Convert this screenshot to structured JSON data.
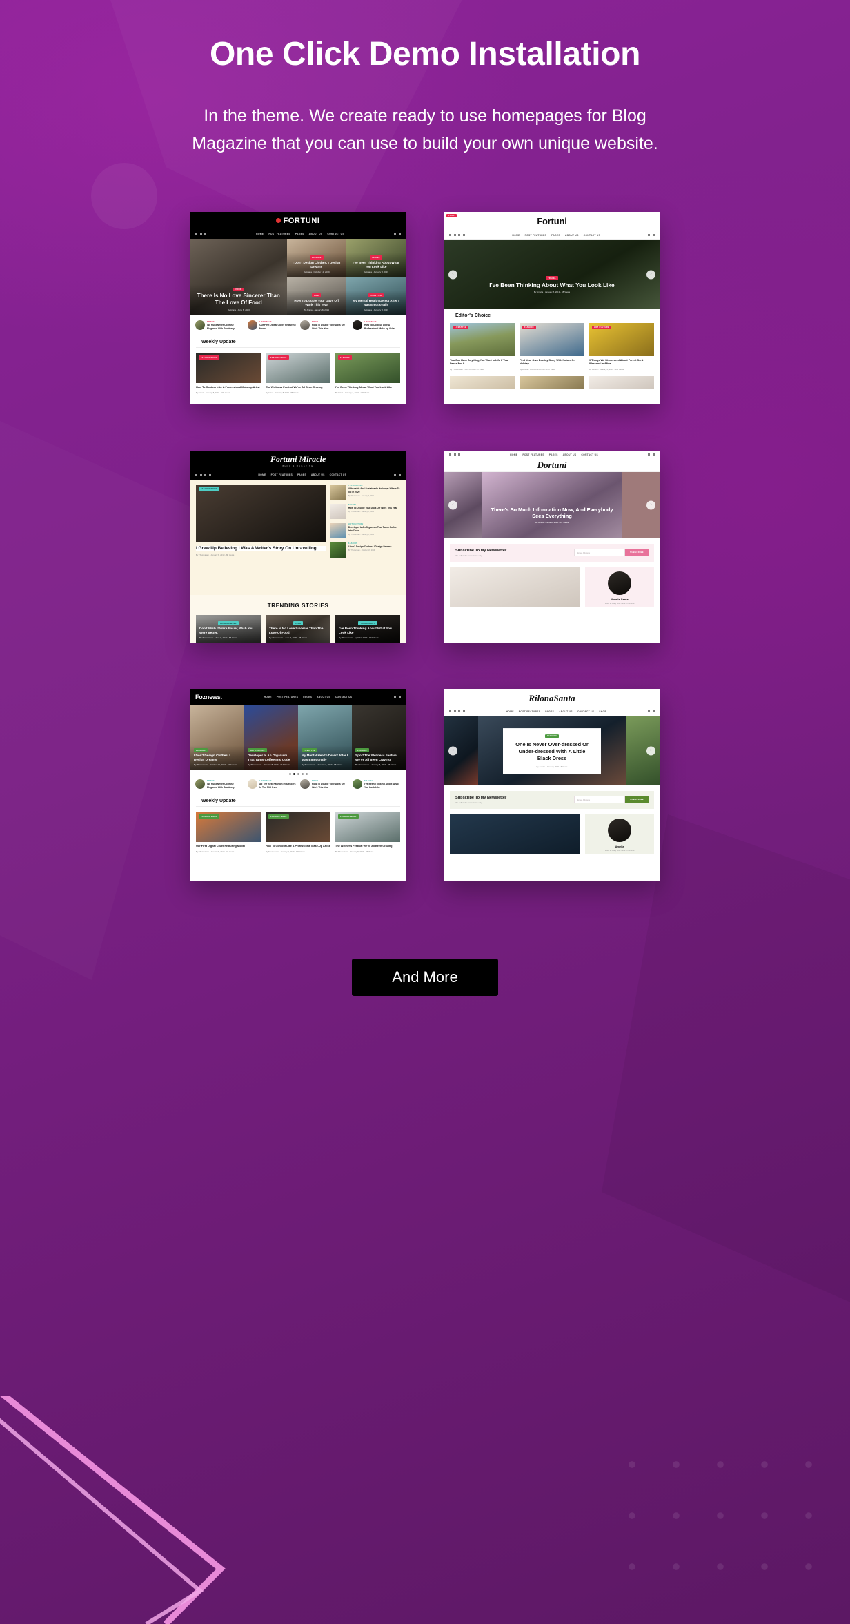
{
  "header": {
    "title": "One Click Demo Installation",
    "subtitle": "In the theme. We create ready to use homepages for Blog Magazine that you can use to build your own unique website."
  },
  "cta": {
    "label": "And More"
  },
  "common": {
    "nav_links": [
      "HOME",
      "POST FEATURES",
      "PAGES",
      "ABOUT US",
      "CONTACT US"
    ],
    "nav_links_shop": [
      "HOME",
      "POST FEATURES",
      "PAGES",
      "ABOUT US",
      "CONTACT US",
      "SHOP"
    ],
    "search_icon": "search-icon",
    "menu_icon": "menu-icon",
    "prev_icon": "‹",
    "next_icon": "›",
    "newsletter_heading": "Subscribe To My Newsletter",
    "newsletter_sub": "We collect the best stories only",
    "newsletter_placeholder": "Email Address",
    "newsletter_button": "SUBSCRIBE"
  },
  "demos": [
    {
      "id": "fortuni-dark",
      "brand": "FORTUNI",
      "hero_main": {
        "badge": "FOOD",
        "title": "There Is No Love Sincerer Than The Love Of Food",
        "meta": "By Arana - June 8, 2020"
      },
      "hero_tiles": [
        {
          "badge": "FASHION",
          "title": "I Don't Design Clothes, I Design Dreams",
          "meta": "By Arana - October 13, 2019"
        },
        {
          "badge": "TRAVEL",
          "title": "I've Been Thinking About What You Look Like",
          "meta": "By Arana - January 8, 2019"
        },
        {
          "badge": "LIFE",
          "title": "How To Double Your Days Off Work This Year",
          "meta": "By Arana - January 8, 2019"
        },
        {
          "badge": "LIFESTYLE",
          "title": "My Mental Health Detect After I Was Emotionally",
          "meta": "By Arana - January 8, 2019"
        }
      ],
      "authors": [
        {
          "cat": "TRAVEL",
          "title": "We Must Never Confuse Elegance With Snobbery"
        },
        {
          "cat": "LIFESTYLE",
          "title": "Our First Digital Cover Featuring Model"
        },
        {
          "cat": "FOOD",
          "title": "How To Double Your Days Off Work This Year"
        },
        {
          "cat": "LIFESTYLE",
          "title": "How To Contour Like A Professional Make-up Artist"
        }
      ],
      "section_title": "Weekly Update",
      "posts": [
        {
          "badge": "FASHION WEEK",
          "title": "How To Contour Like A Professional Make-up Artist",
          "meta": "By Arana - January 8, 2019 - 130 Views"
        },
        {
          "badge": "FASHION WEEK",
          "title": "The Wellness Festival We've All Been Craving",
          "meta": "By Arana - January 8, 2019 - 88 Views"
        },
        {
          "badge": "FASHION",
          "title": "I've Been Thinking About What You Look Like",
          "meta": "By Arana - January 8, 2019 - 130 Views"
        }
      ]
    },
    {
      "id": "fortuni-light",
      "brand": "Fortuni",
      "hero": {
        "badge": "TRAVEL",
        "title": "I've Been Thinking About What You Look Like",
        "meta": "By Amelia - January 8, 2019 - 98 Views"
      },
      "section_title": "Editor's Choice",
      "posts": [
        {
          "badge": "LIFESTYLE",
          "title": "You Can Have Anything You Want In Life If You Dress For It.",
          "meta": "By Themeteam - June 8, 2020 - 5 Views"
        },
        {
          "badge": "FASHION",
          "title": "Find Your Own Destiny Story With Nature On Holiday",
          "meta": "By Amelia - October 13, 2019 - 126 Views"
        },
        {
          "badge": "HOT CULTURE",
          "title": "9 Things We Discovered About Forest On A Weekend In Afica",
          "meta": "By Amelia - January 8, 2019 - 140 Views"
        }
      ]
    },
    {
      "id": "fortuni-miracle",
      "brand": "Fortuni Miracle",
      "brand_sub": "BLOG & MAGAZINE",
      "feature": {
        "badge": "FASHION WEEK",
        "title": "I Grew Up Believing I Was A Writer's Story On Unravelling",
        "meta": "By Themeteam - January 8, 2019 - 88 Views"
      },
      "sidebar_posts": [
        {
          "cat": "TECHNOLOGY",
          "title": "Affordable And Sustainable Holidays: Where To Go In 2020",
          "meta": "By Themeteam - January 8, 2019"
        },
        {
          "cat": "TRAVEL",
          "title": "How To Double Your Days Off Work This Year",
          "meta": "By Themeteam - January 8, 2019"
        },
        {
          "cat": "HOT CULTURE",
          "title": "Developer Is An Organism That Turns Coffee Into Code",
          "meta": "By Themeteam - January 8, 2019"
        },
        {
          "cat": "FASHION",
          "title": "I Don't Design Clothes, I Design Dreams",
          "meta": "By Themeteam - October 13, 2019"
        }
      ],
      "section_title": "TRENDING STORIES",
      "trending": [
        {
          "badge": "FASHION WEEK",
          "title": "Don't Wish It Were Easier, Wish You Were Better.",
          "meta": "By Themeteam - June 8, 2020 - 55 Views"
        },
        {
          "badge": "FOOD",
          "title": "There Is No Love Sincerer Than The Love Of Food.",
          "meta": "By Themeteam - June 8, 2020 - 88 Views"
        },
        {
          "badge": "TECHNOLOGY",
          "title": "I've Been Thinking About What You Look Like",
          "meta": "By Themeteam - April 21, 2019 - 122 Views"
        }
      ]
    },
    {
      "id": "dortuni",
      "brand": "Dortuni",
      "hero": {
        "title": "There's So Much Information Now, And Everybody Sees Everything",
        "meta": "By Amelia - June 8, 2020 - 12 Views"
      },
      "author": {
        "name": "Amalia Santa",
        "desc": "Want to really sexy more. Thandfize"
      }
    },
    {
      "id": "foznews",
      "brand": "Foznews.",
      "hero_tiles": [
        {
          "badge": "FASHION",
          "title": "I Don't Design Clothes, I Design Dreams",
          "meta": "By Themeteam - October 13, 2019 - 198 Views"
        },
        {
          "badge": "HOT CULTURE",
          "title": "Developer Is An Organism That Turns Coffee Into Code",
          "meta": "By Themeteam - January 8, 2019 - 214 Views"
        },
        {
          "badge": "LIFESTYLE",
          "title": "My Mental Health Detect After I Was Emotionally",
          "meta": "By Themeteam - January 8, 2019 - 88 Views"
        },
        {
          "badge": "FASHION",
          "title": "Sport The Wellness Festival We've All Been Craving",
          "meta": "By Themeteam - January 8, 2019 - 36 Views"
        }
      ],
      "authors": [
        {
          "cat": "TRAVEL",
          "title": "We Must Never Confuse Elegance With Snobbery"
        },
        {
          "cat": "LIFESTYLE",
          "title": "All The Best Fashion Influencers In The Mid Over"
        },
        {
          "cat": "FOOD",
          "title": "How To Double Your Days Off Work This Year"
        },
        {
          "cat": "TRAVEL",
          "title": "I've Been Thinking About What You Look Like"
        }
      ],
      "section_title": "Weekly Update",
      "posts": [
        {
          "badge": "FASHION WEEK",
          "title": "Our First Digital Cover Featuring Model",
          "meta": "By Themeteam - January 8, 2019 - 71 Views"
        },
        {
          "badge": "FASHION WEEK",
          "title": "How To Contour Like A Professional Make-Up Artist",
          "meta": "By Themeteam - January 8, 2019 - 130 Views"
        },
        {
          "badge": "FASHION WEEK",
          "title": "The Wellness Festival We've All Been Craving",
          "meta": "By Themeteam - January 8, 2019 - 58 Views"
        }
      ]
    },
    {
      "id": "rilonasanta",
      "brand": "RilonaSanta",
      "hero": {
        "badge": "FASHION",
        "title": "One Is Never Over-dressed Or Under-dressed With A Little Black Dress",
        "meta": "By Amelia - June 13, 2020 - 8 Views"
      },
      "author": {
        "name": "Amelia",
        "desc": "Want to really sexy more. Thandfize"
      }
    }
  ]
}
